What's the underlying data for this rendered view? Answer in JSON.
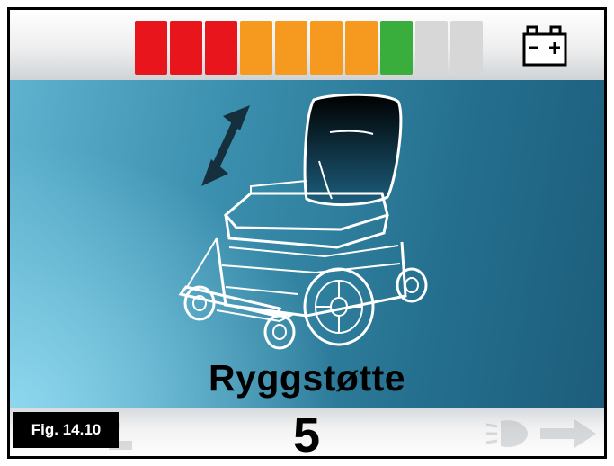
{
  "top_bar": {
    "battery_segments": [
      {
        "state": "on",
        "color": "#e8151d"
      },
      {
        "state": "on",
        "color": "#e8151d"
      },
      {
        "state": "on",
        "color": "#e8151d"
      },
      {
        "state": "on",
        "color": "#f59a1f"
      },
      {
        "state": "on",
        "color": "#f59a1f"
      },
      {
        "state": "on",
        "color": "#f59a1f"
      },
      {
        "state": "on",
        "color": "#f59a1f"
      },
      {
        "state": "on",
        "color": "#3aae3c"
      },
      {
        "state": "off",
        "color": "#d7d7d7"
      },
      {
        "state": "off",
        "color": "#d7d7d7"
      }
    ],
    "battery_level": 0.8,
    "battery_icon": "battery-icon"
  },
  "main": {
    "illustration": "wheelchair-backrest-tilt-icon",
    "adjust_arrow": "double-arrow-icon",
    "function_label": "Ryggstøtte"
  },
  "bottom_bar": {
    "value": "5",
    "left_nav_icon": "left-arrow-icon",
    "right_nav_icon": "right-arrow-icon",
    "light_icon": "headlight-icon"
  },
  "figure_label": "Fig. 14.10",
  "colors": {
    "frame": "#000000",
    "background_dark": "#1c5d7b",
    "background_light": "#8ed7ee"
  }
}
